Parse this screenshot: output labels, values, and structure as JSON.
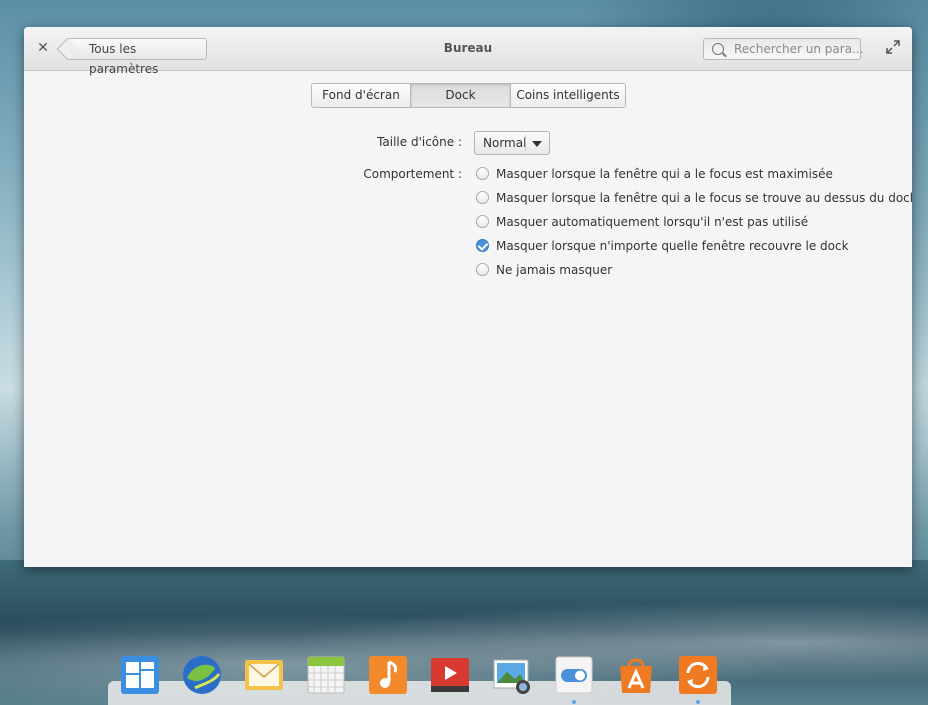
{
  "window": {
    "title": "Bureau",
    "back_label": "Tous les paramètres",
    "search_placeholder": "Rechercher un para..."
  },
  "tabs": [
    {
      "label": "Fond d'écran",
      "active": false
    },
    {
      "label": "Dock",
      "active": true
    },
    {
      "label": "Coins intelligents",
      "active": false
    }
  ],
  "settings": {
    "icon_size_label": "Taille d'icône :",
    "icon_size_value": "Normal",
    "behavior_label": "Comportement :",
    "options": [
      {
        "label": "Masquer lorsque la fenêtre qui a le focus est maximisée",
        "checked": false
      },
      {
        "label": "Masquer lorsque la fenêtre qui a le focus se trouve au dessus du dock",
        "checked": false
      },
      {
        "label": "Masquer automatiquement lorsqu'il n'est pas utilisé",
        "checked": false
      },
      {
        "label": "Masquer lorsque n'importe quelle fenêtre recouvre le dock",
        "checked": true
      },
      {
        "label": "Ne jamais masquer",
        "checked": false
      }
    ]
  },
  "dock": {
    "apps": [
      {
        "icon": "multitasking-view-icon",
        "running": false
      },
      {
        "icon": "web-browser-icon",
        "running": false
      },
      {
        "icon": "mail-icon",
        "running": false
      },
      {
        "icon": "calendar-icon",
        "running": false
      },
      {
        "icon": "music-icon",
        "running": false
      },
      {
        "icon": "videos-icon",
        "running": false
      },
      {
        "icon": "photos-icon",
        "running": false
      },
      {
        "icon": "system-settings-icon",
        "running": true
      },
      {
        "icon": "app-center-icon",
        "running": false
      },
      {
        "icon": "software-update-icon",
        "running": true
      }
    ]
  },
  "colors": {
    "accent": "#4a90d9",
    "window_bg": "#f5f5f5"
  }
}
